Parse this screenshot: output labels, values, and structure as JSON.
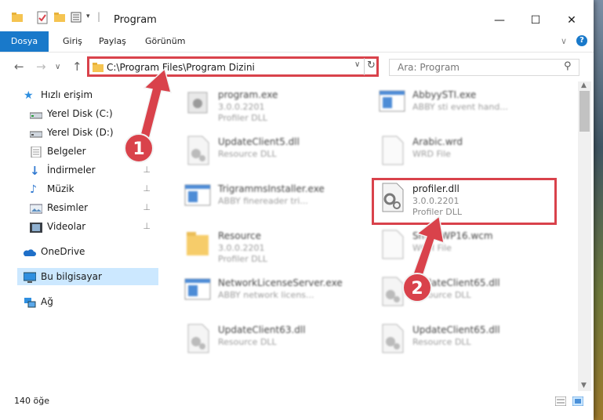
{
  "window": {
    "title": "Program"
  },
  "ribbon": {
    "tabs": [
      "Dosya",
      "Giriş",
      "Paylaş",
      "Görünüm"
    ]
  },
  "address": {
    "path": "C:\\Program Files\\Program Dizini"
  },
  "search": {
    "placeholder": "Ara: Program"
  },
  "sidebar": {
    "items": [
      {
        "label": "Hızlı erişim",
        "icon": "star-icon"
      },
      {
        "label": "Yerel Disk (C:)",
        "icon": "drive-icon"
      },
      {
        "label": "Yerel Disk (D:)",
        "icon": "drive-icon"
      },
      {
        "label": "Belgeler",
        "icon": "documents-icon"
      },
      {
        "label": "İndirmeler",
        "icon": "download-icon"
      },
      {
        "label": "Müzik",
        "icon": "music-icon"
      },
      {
        "label": "Resimler",
        "icon": "pictures-icon"
      },
      {
        "label": "Videolar",
        "icon": "videos-icon"
      },
      {
        "label": "OneDrive",
        "icon": "cloud-icon"
      },
      {
        "label": "Bu bilgisayar",
        "icon": "computer-icon"
      },
      {
        "label": "Ağ",
        "icon": "network-icon"
      }
    ]
  },
  "files": [
    {
      "name": "program.exe",
      "line1": "3.0.0.2201",
      "line2": "Profiler DLL"
    },
    {
      "name": "AbbyySTI.exe",
      "line1": "ABBY sti event hand...",
      "line2": ""
    },
    {
      "name": "UpdateClient5.dll",
      "line1": "Resource DLL",
      "line2": ""
    },
    {
      "name": "Arabic.wrd",
      "line1": "WRD File",
      "line2": ""
    },
    {
      "name": "TrigrammsInstaller.exe",
      "line1": "ABBY finereader tri...",
      "line2": ""
    },
    {
      "name": "profiler.dll",
      "line1": "3.0.0.2201",
      "line2": "Profiler DLL"
    },
    {
      "name": "Resource",
      "line1": "3.0.0.2201",
      "line2": "Profiler DLL"
    },
    {
      "name": "SmartWP16.wcm",
      "line1": "WCM File",
      "line2": ""
    },
    {
      "name": "NetworkLicenseServer.exe",
      "line1": "ABBY network licens...",
      "line2": ""
    },
    {
      "name": "UpdateClient65.dll",
      "line1": "Resource DLL",
      "line2": ""
    },
    {
      "name": "UpdateClient63.dll",
      "line1": "Resource DLL",
      "line2": ""
    },
    {
      "name": "UpdateClient65.dll",
      "line1": "Resource DLL",
      "line2": ""
    }
  ],
  "status": {
    "count": "140 öğe"
  },
  "annotations": {
    "step1": "1",
    "step2": "2"
  },
  "colors": {
    "accent": "#1979ca",
    "highlight": "#d9424b",
    "selection": "#cce8ff"
  }
}
